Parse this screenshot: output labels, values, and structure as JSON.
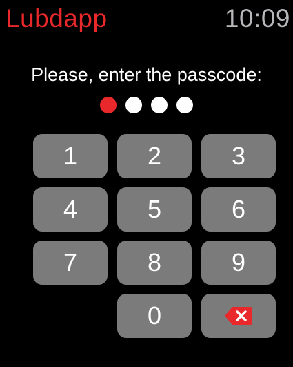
{
  "header": {
    "app_title": "Lubdapp",
    "time": "10:09"
  },
  "prompt": "Please, enter the passcode:",
  "passcode": {
    "length": 4,
    "entered": 1
  },
  "keypad": {
    "keys": [
      "1",
      "2",
      "3",
      "4",
      "5",
      "6",
      "7",
      "8",
      "9",
      "0"
    ],
    "delete_icon": "delete-backspace-icon"
  },
  "colors": {
    "accent": "#e8282b",
    "empty_dot": "#ffffff",
    "key_background": "#7b7b7b",
    "background": "#000000",
    "clock": "#b8b8bc"
  }
}
